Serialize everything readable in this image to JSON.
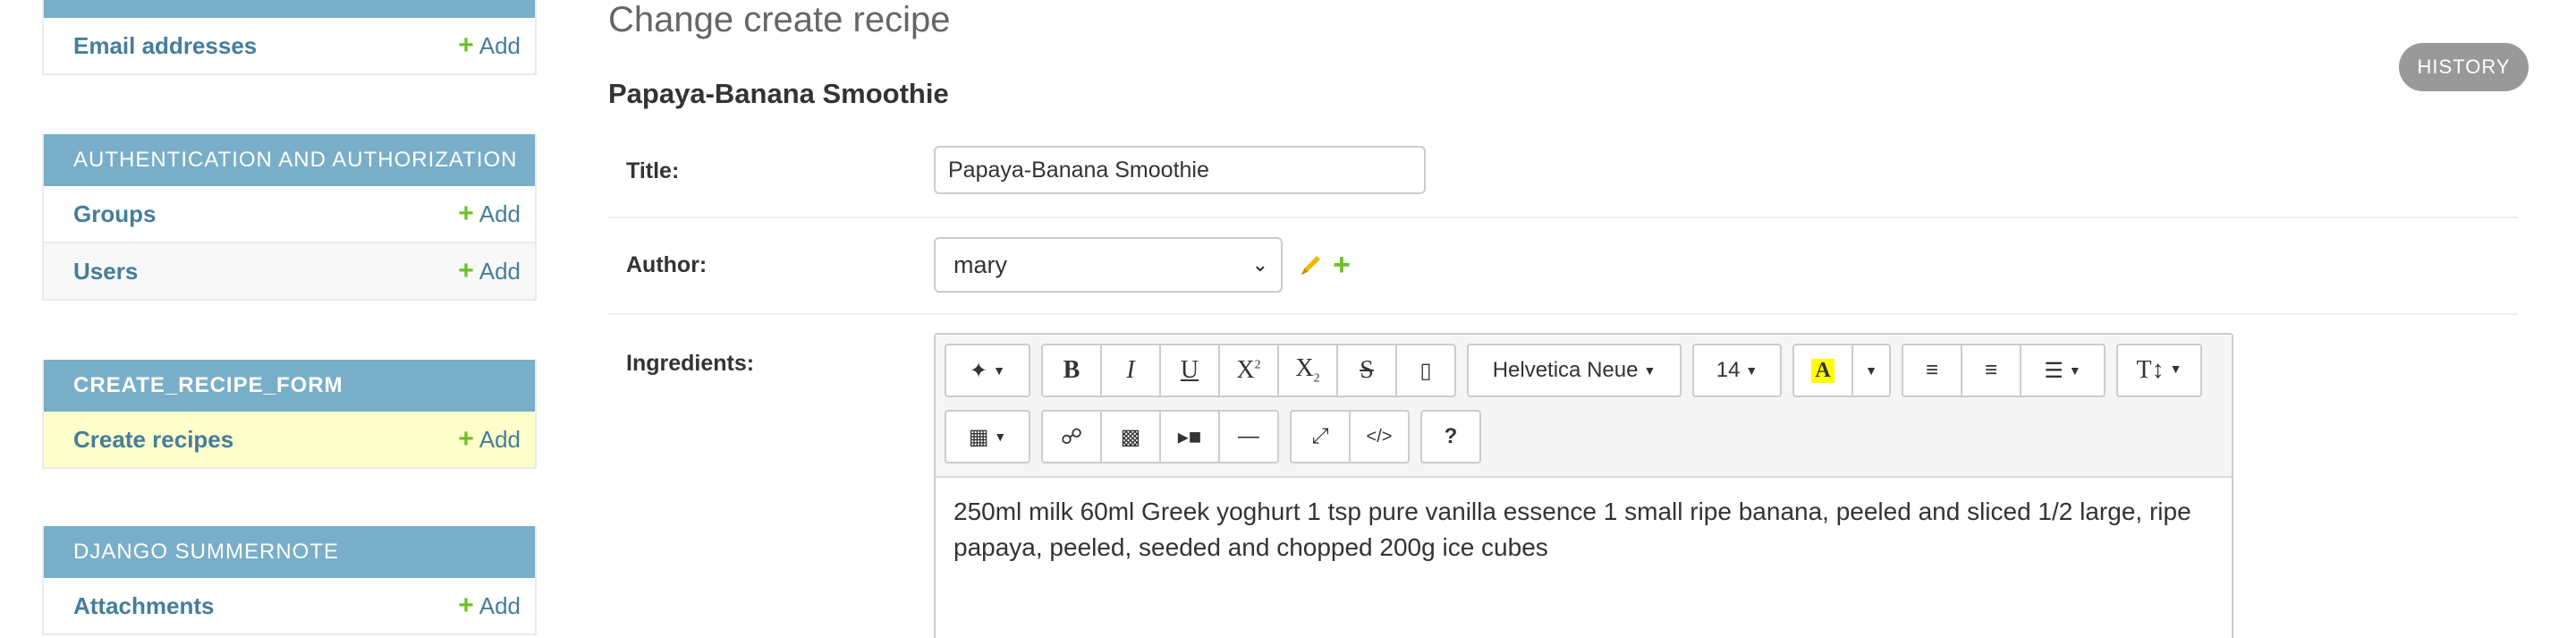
{
  "sidebar": {
    "top_row": {
      "label": "Email addresses",
      "add": "Add"
    },
    "modules": [
      {
        "header": "Authentication and Authorization",
        "rows": [
          {
            "label": "Groups",
            "add": "Add"
          },
          {
            "label": "Users",
            "add": "Add"
          }
        ]
      },
      {
        "header": "CREATE_RECIPE_FORM",
        "rows": [
          {
            "label": "Create recipes",
            "add": "Add"
          }
        ]
      },
      {
        "header": "Django Summernote",
        "rows": [
          {
            "label": "Attachments",
            "add": "Add"
          }
        ]
      }
    ]
  },
  "main": {
    "page_title": "Change create recipe",
    "history_label": "HISTORY",
    "object_title": "Papaya-Banana Smoothie",
    "fields": {
      "title": {
        "label": "Title:",
        "value": "Papaya-Banana Smoothie"
      },
      "author": {
        "label": "Author:",
        "value": "mary"
      },
      "ingredients": {
        "label": "Ingredients:"
      }
    },
    "editor": {
      "font_name": "Helvetica Neue",
      "font_size": "14",
      "content": "250ml milk 60ml Greek yoghurt 1 tsp pure vanilla essence 1 small ripe banana, peeled and sliced 1/2 large, ripe papaya, peeled, seeded and chopped 200g ice cubes"
    }
  },
  "colors": {
    "module_header": "#79aec8",
    "link": "#447e9b",
    "add_green": "#70bf2b",
    "current_row": "#ffffcc"
  }
}
